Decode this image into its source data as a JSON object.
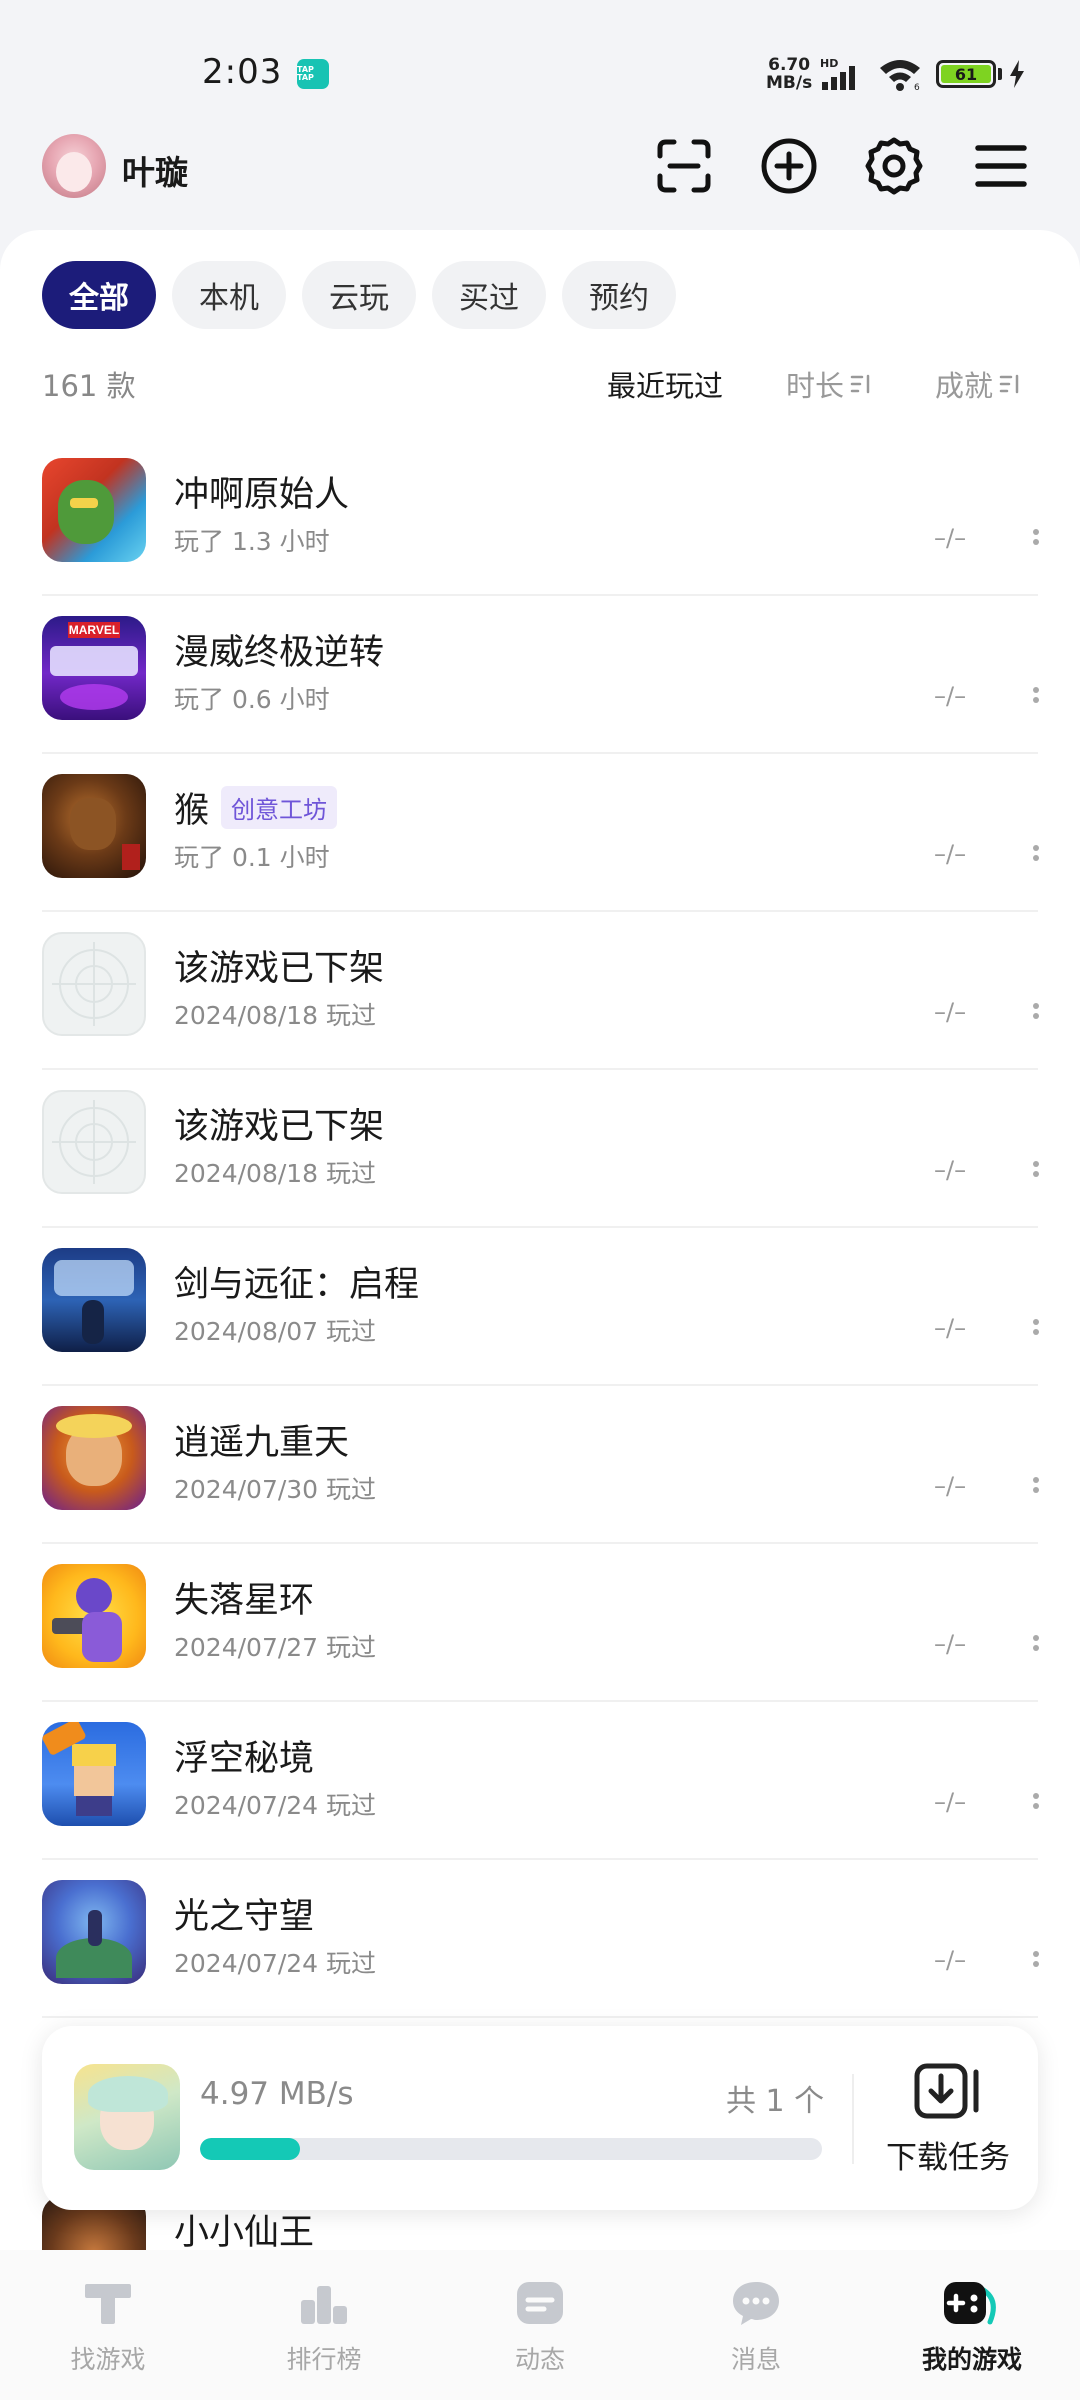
{
  "status_bar": {
    "time": "2:03",
    "app_badge": "TAP TAP",
    "net_speed_value": "6.70",
    "net_speed_unit": "MB/s",
    "battery": "61"
  },
  "header": {
    "username": "叶璇"
  },
  "filters": [
    "全部",
    "本机",
    "云玩",
    "买过",
    "预约"
  ],
  "list_header": {
    "count": "161 款",
    "sort_recent": "最近玩过",
    "sort_duration": "时长",
    "sort_achievement": "成就"
  },
  "games": [
    {
      "title": "冲啊原始人",
      "sub": "玩了 1.3 小时",
      "score": "–/–",
      "tag": ""
    },
    {
      "title": "漫威终极逆转",
      "sub": "玩了 0.6 小时",
      "score": "–/–",
      "tag": ""
    },
    {
      "title": "猴",
      "sub": "玩了 0.1 小时",
      "score": "–/–",
      "tag": "创意工坊"
    },
    {
      "title": "该游戏已下架",
      "sub": "2024/08/18 玩过",
      "score": "–/–",
      "tag": ""
    },
    {
      "title": "该游戏已下架",
      "sub": "2024/08/18 玩过",
      "score": "–/–",
      "tag": ""
    },
    {
      "title": "剑与远征：启程",
      "sub": "2024/08/07 玩过",
      "score": "–/–",
      "tag": ""
    },
    {
      "title": "逍遥九重天",
      "sub": "2024/07/30 玩过",
      "score": "–/–",
      "tag": ""
    },
    {
      "title": "失落星环",
      "sub": "2024/07/27 玩过",
      "score": "–/–",
      "tag": ""
    },
    {
      "title": "浮空秘境",
      "sub": "2024/07/24 玩过",
      "score": "–/–",
      "tag": ""
    },
    {
      "title": "光之守望",
      "sub": "2024/07/24 玩过",
      "score": "–/–",
      "tag": ""
    },
    {
      "title": "",
      "sub": "",
      "score": "",
      "tag": ""
    },
    {
      "title": "小小仙王",
      "sub": "",
      "score": "",
      "tag": ""
    }
  ],
  "download": {
    "speed": "4.97 MB/s",
    "total": "共 1 个",
    "progress": 0.16,
    "task_label": "下载任务"
  },
  "bottom_nav": [
    "找游戏",
    "排行榜",
    "动态",
    "消息",
    "我的游戏"
  ],
  "colors": {
    "accent": "#1c1c7a",
    "progress": "#14c9b6",
    "tag_text": "#6f55d8"
  }
}
